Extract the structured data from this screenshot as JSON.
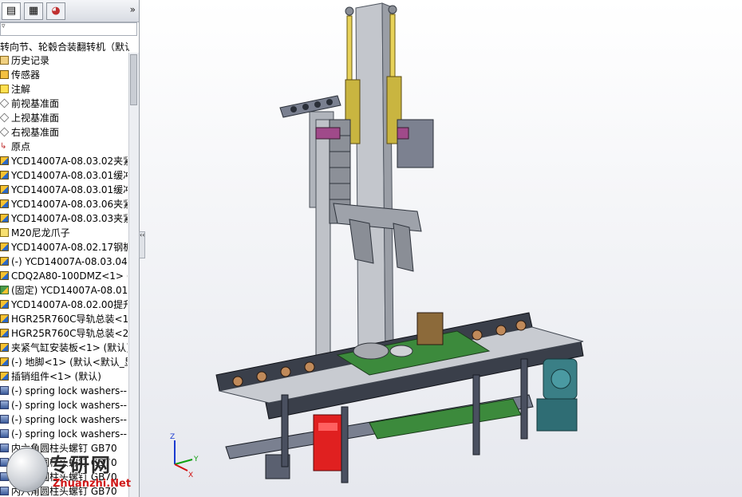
{
  "feature_tree": {
    "tabs": [
      {
        "name": "featuremanager-tab",
        "glyph": "▤"
      },
      {
        "name": "propertymanager-tab",
        "glyph": "▦"
      },
      {
        "name": "display-manager-tab",
        "glyph": "◕"
      }
    ],
    "expand_label": "»",
    "filter_label": "▿",
    "root_label": "转向节、轮毂合装翻转机（默认",
    "items": [
      {
        "icon": "history",
        "label": "历史记录"
      },
      {
        "icon": "sensor",
        "label": "传感器"
      },
      {
        "icon": "note",
        "label": "注解"
      },
      {
        "icon": "plane",
        "label": "前视基准面"
      },
      {
        "icon": "plane",
        "label": "上视基准面"
      },
      {
        "icon": "plane",
        "label": "右视基准面"
      },
      {
        "icon": "origin",
        "label": "原点"
      },
      {
        "icon": "asm",
        "label": "YCD14007A-08.03.02夹紧"
      },
      {
        "icon": "asm",
        "label": "YCD14007A-08.03.01缓冲"
      },
      {
        "icon": "asm",
        "label": "YCD14007A-08.03.01缓冲"
      },
      {
        "icon": "asm",
        "label": "YCD14007A-08.03.06夹紧"
      },
      {
        "icon": "asm",
        "label": "YCD14007A-08.03.03夹紧"
      },
      {
        "icon": "part",
        "label": "M20尼龙爪子"
      },
      {
        "icon": "asm",
        "label": "YCD14007A-08.02.17钢板"
      },
      {
        "icon": "asm",
        "label": "(-) YCD14007A-08.03.04拉"
      },
      {
        "icon": "asm",
        "label": "CDQ2A80-100DMZ<1> ("
      },
      {
        "icon": "fixed",
        "label": "(固定) YCD14007A-08.01.0"
      },
      {
        "icon": "asm",
        "label": "YCD14007A-08.02.00提升"
      },
      {
        "icon": "asm",
        "label": "HGR25R760C导轨总装<1>"
      },
      {
        "icon": "asm",
        "label": "HGR25R760C导轨总装<2>"
      },
      {
        "icon": "asm",
        "label": "夹紧气缸安装板<1> (默认)"
      },
      {
        "icon": "asm",
        "label": "(-) 地脚<1> (默认<默认_显"
      },
      {
        "icon": "asm",
        "label": "插销组件<1> (默认)"
      },
      {
        "icon": "bolt",
        "label": "(-) spring lock washers--n"
      },
      {
        "icon": "bolt",
        "label": "(-) spring lock washers--n"
      },
      {
        "icon": "bolt",
        "label": "(-) spring lock washers--n"
      },
      {
        "icon": "bolt",
        "label": "(-) spring lock washers--n"
      },
      {
        "icon": "bolt",
        "label": "内六角圆柱头螺钉 GB70"
      },
      {
        "icon": "bolt",
        "label": "内六角圆柱头螺钉 GB70"
      },
      {
        "icon": "bolt",
        "label": "内六角圆柱头螺钉 GB70"
      },
      {
        "icon": "bolt",
        "label": "内六角圆柱头螺钉 GB70"
      }
    ],
    "collapse_grip_label": "‹‹"
  },
  "watermark": {
    "text": "专研网",
    "url": "Zhuanzhi.Net"
  },
  "triad": {
    "x": "X",
    "y": "Y",
    "z": "Z"
  },
  "colors": {
    "frame_grey": "#b9bcc2",
    "rail_dark": "#3a3f4a",
    "cylinder_yellow": "#e8d25a",
    "motor_teal": "#3a7f86",
    "valve_red": "#e02020",
    "board_green": "#3c8a3c"
  }
}
